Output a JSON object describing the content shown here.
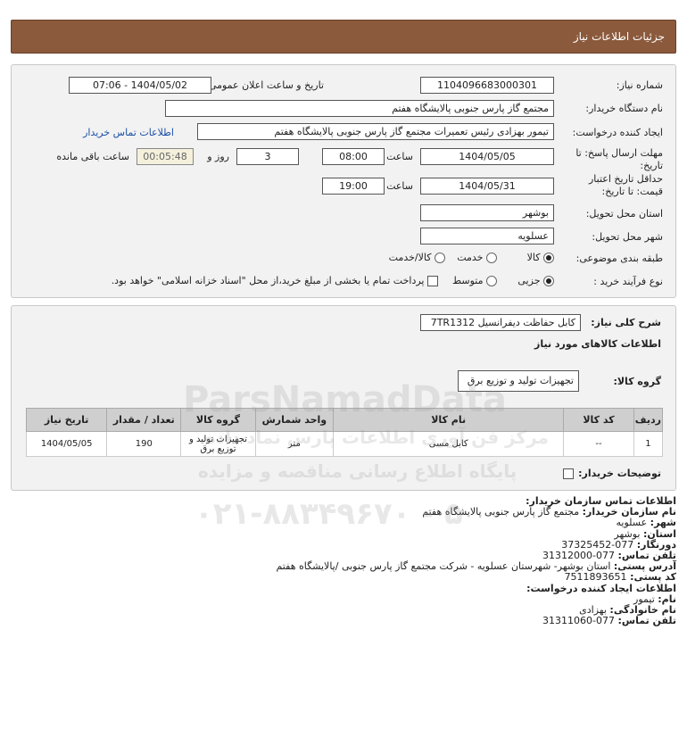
{
  "page": {
    "title": "جزئیات اطلاعات نیاز"
  },
  "need": {
    "number_label": "شماره نیاز:",
    "number": "1104096683000301",
    "announce_label": "تاریخ و ساعت اعلان عمومی:",
    "announce": "1404/05/02 - 07:06",
    "buyer_label": "نام دستگاه خریدار:",
    "buyer": "مجتمع گاز پارس جنوبی  پالایشگاه هفتم",
    "creator_label": "ایجاد کننده درخواست:",
    "creator": "تیمور بهزادی رئیس تعمیرات مجتمع گاز پارس جنوبی  پالایشگاه هفتم",
    "contact_link": "اطلاعات تماس خریدار",
    "deadline_label": "مهلت ارسال پاسخ: تا تاریخ:",
    "deadline_date": "1404/05/05",
    "time_label": "ساعت",
    "deadline_time": "08:00",
    "days": "3",
    "days_label": "روز و",
    "remaining": "00:05:48",
    "remaining_label": "ساعت باقی مانده",
    "validity_label": "حداقل تاریخ اعتبار قیمت: تا تاریخ:",
    "validity_date": "1404/05/31",
    "validity_time": "19:00",
    "province_label": "استان محل تحویل:",
    "province": "بوشهر",
    "city_label": "شهر محل تحویل:",
    "city": "عسلویه",
    "category_label": "طبقه بندی موضوعی:",
    "category_options": [
      "کالا",
      "خدمت",
      "کالا/خدمت"
    ],
    "process_label": "نوع فرآیند خرید :",
    "process_options": [
      "جزیی",
      "متوسط"
    ],
    "payment_note": "پرداخت تمام یا بخشی از مبلغ خرید،از محل \"اسناد خزانه اسلامی\" خواهد بود."
  },
  "details": {
    "desc_label": "شرح کلی نیاز:",
    "desc": "کابل حفاظت دیفرانسیل 7TR1312",
    "goods_heading": "اطلاعات کالاهای مورد نیاز",
    "group_label": "گروه کالا:",
    "group": "تجهیزات تولید و توزیع برق",
    "columns": [
      "ردیف",
      "کد کالا",
      "نام کالا",
      "واحد شمارش",
      "گروه کالا",
      "تعداد / مقدار",
      "تاریخ نیاز"
    ],
    "rows": [
      [
        "1",
        "--",
        "کابل مسی",
        "متر",
        "تجهیزات تولید و توزیع برق",
        "190",
        "1404/05/05"
      ]
    ],
    "buyer_notes_label": "توضیحات خریدار:"
  },
  "contact": {
    "org_heading": "اطلاعات تماس سازمان خریدار:",
    "org_name_label": "نام سازمان خریدار:",
    "org_name": "مجتمع گاز پارس جنوبی پالایشگاه هفتم",
    "city_label": "شهر:",
    "city": "عسلویه",
    "province_label": "استان:",
    "province": "بوشهر",
    "fax_label": "دورنگار:",
    "fax": "077-37325452",
    "phone_label": "تلفن تماس:",
    "phone": "077-31312000",
    "address_label": "آدرس پستی:",
    "address": "استان بوشهر- شهرستان عسلویه - شرکت مجتمع گاز پارس جنوبی /پالایشگاه هفتم",
    "postal_label": "کد پستی:",
    "postal": "7511893651",
    "creator_heading": "اطلاعات ایجاد کننده درخواست:",
    "first_name_label": "نام:",
    "first_name": "تیمور",
    "last_name_label": "نام خانوادگی:",
    "last_name": "بهزادی",
    "creator_phone_label": "تلفن تماس:",
    "creator_phone": "077-31311060"
  },
  "watermark": {
    "brand": "ParsNamadData",
    "line1": "مرکز فن آوری اطلاعات پارس نماد داده",
    "line2": "پایگاه اطلاع رسانی مناقصه و مزایده",
    "phone": "۰۲۱-۸۸۳۴۹۶۷۰ - ۵"
  }
}
